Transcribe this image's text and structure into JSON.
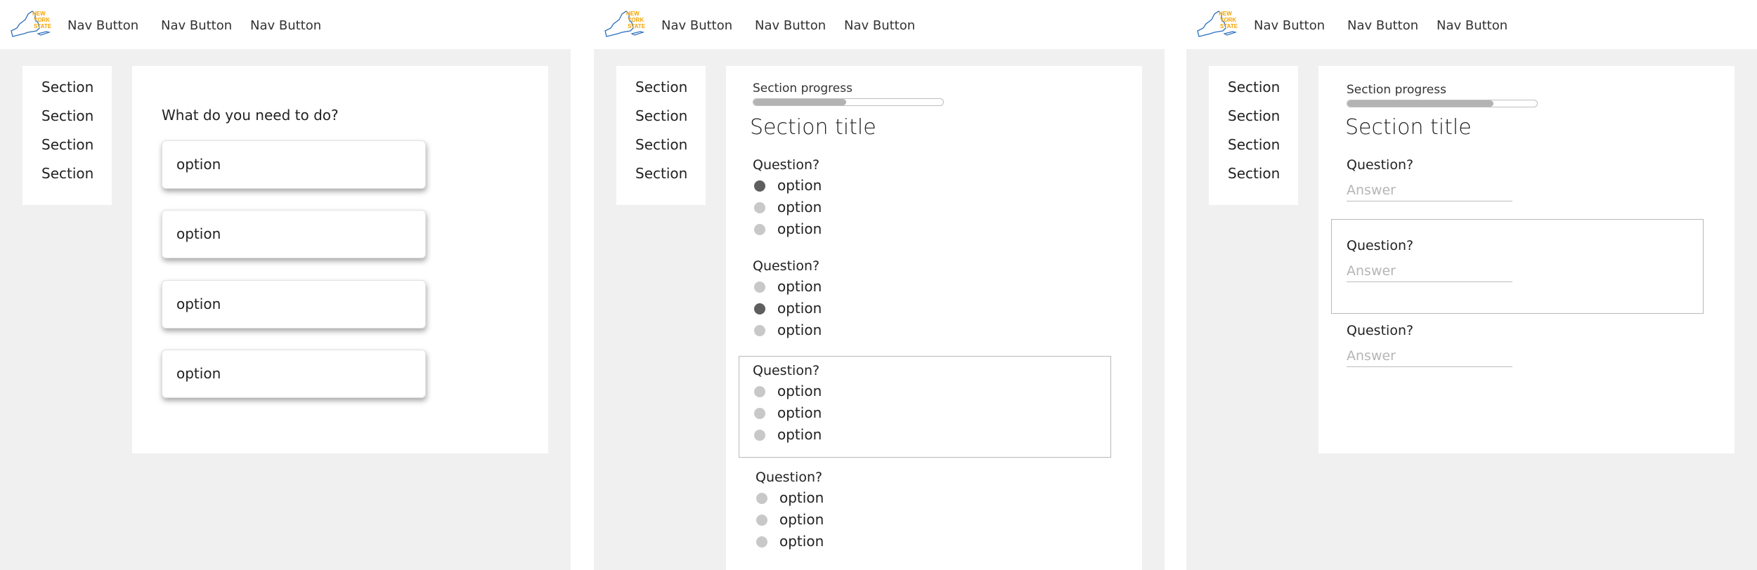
{
  "brand": {
    "logo_text": [
      "NEW",
      "YORK",
      "STATE"
    ],
    "logo_color": "#f4a300",
    "outline_color": "#2a6ebb"
  },
  "colors": {
    "background": "#f0f0f0",
    "card": "#ffffff",
    "radio_selected": "#5e5e5e",
    "radio_unselected": "#c8c8c8",
    "progress_fill": "#b3b3b3"
  },
  "screens": [
    {
      "nav": [
        "Nav Button",
        "Nav Button",
        "Nav Button"
      ],
      "sidebar": [
        "Section",
        "Section",
        "Section",
        "Section"
      ],
      "prompt": "What do you need to do?",
      "options": [
        "option",
        "option",
        "option",
        "option"
      ]
    },
    {
      "nav": [
        "Nav Button",
        "Nav Button",
        "Nav Button"
      ],
      "sidebar": [
        "Section",
        "Section",
        "Section",
        "Section"
      ],
      "progress_label": "Section progress",
      "progress": 0.49,
      "title": "Section title",
      "questions": [
        {
          "label": "Question?",
          "options": [
            "option",
            "option",
            "option"
          ],
          "selected": 0
        },
        {
          "label": "Question?",
          "options": [
            "option",
            "option",
            "option"
          ],
          "selected": 1
        },
        {
          "label": "Question?",
          "options": [
            "option",
            "option",
            "option"
          ],
          "selected": null
        },
        {
          "label": "Question?",
          "options": [
            "option",
            "option",
            "option"
          ],
          "selected": null
        }
      ]
    },
    {
      "nav": [
        "Nav Button",
        "Nav Button",
        "Nav Button"
      ],
      "sidebar": [
        "Section",
        "Section",
        "Section",
        "Section"
      ],
      "progress_label": "Section progress",
      "progress": 0.77,
      "title": "Section title",
      "questions": [
        {
          "label": "Question?",
          "placeholder": "Answer"
        },
        {
          "label": "Question?",
          "placeholder": "Answer"
        },
        {
          "label": "Question?",
          "placeholder": "Answer"
        }
      ]
    }
  ]
}
